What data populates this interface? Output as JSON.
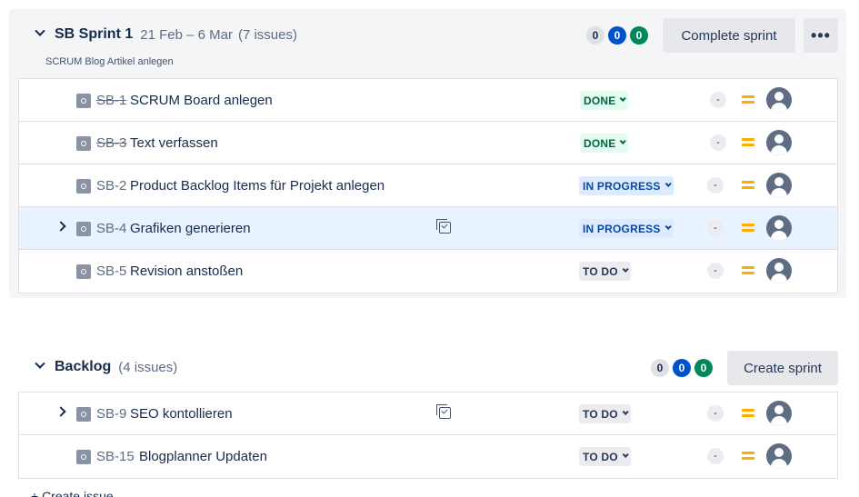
{
  "sprint": {
    "title": "SB Sprint 1",
    "dates": "21 Feb – 6 Mar",
    "issue_count": "(7 issues)",
    "goal": "SCRUM Blog Artikel anlegen",
    "counts": {
      "todo": "0",
      "in_progress": "0",
      "done": "0"
    },
    "complete_label": "Complete sprint",
    "more_label": "•••",
    "issues": [
      {
        "key": "SB-1",
        "summary": "SCRUM Board anlegen",
        "status": "DONE",
        "estimate": "-"
      },
      {
        "key": "SB-3",
        "summary": "Text verfassen",
        "status": "DONE",
        "estimate": "-"
      },
      {
        "key": "SB-2",
        "summary": "Product Backlog Items für Projekt anlegen",
        "status": "IN PROGRESS",
        "estimate": "-"
      },
      {
        "key": "SB-4",
        "summary": "Grafiken generieren",
        "status": "IN PROGRESS",
        "estimate": "-"
      },
      {
        "key": "SB-5",
        "summary": "Revision anstoßen",
        "status": "TO DO",
        "estimate": "-"
      }
    ]
  },
  "backlog": {
    "title": "Backlog",
    "issue_count": "(4 issues)",
    "counts": {
      "todo": "0",
      "in_progress": "0",
      "done": "0"
    },
    "create_label": "Create sprint",
    "issues": [
      {
        "key": "SB-9",
        "summary": "SEO kontollieren",
        "status": "TO DO",
        "estimate": "-"
      },
      {
        "key": "SB-15",
        "summary": "Blogplanner Updaten",
        "status": "TO DO",
        "estimate": "-"
      }
    ]
  },
  "footer": {
    "create_issue": "+ Create issue"
  },
  "colors": {
    "done_bg": "#e3fcef",
    "done_fg": "#006644",
    "progress_bg": "#deebff",
    "progress_fg": "#0747a6",
    "todo_bg": "#ebecf0",
    "todo_fg": "#253858",
    "priority_medium": "#ffab00",
    "selected_row": "#e9f2ff"
  }
}
